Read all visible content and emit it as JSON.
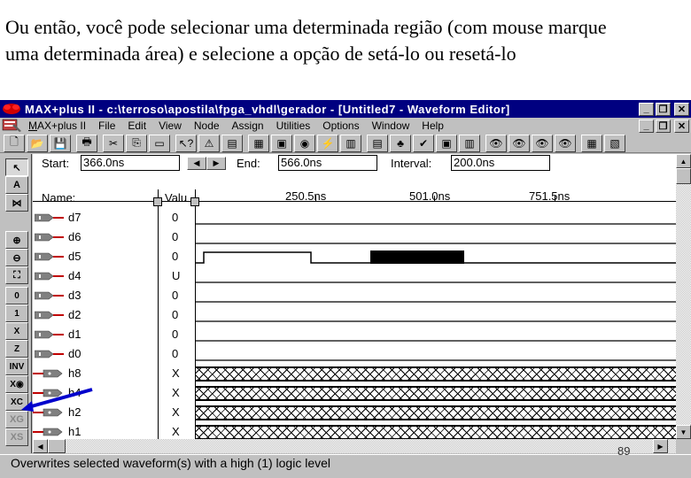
{
  "slide": {
    "line1": "Ou então, você pode selecionar uma determinada região (com mouse marque",
    "line2": "uma determinada área) e selecione a opção de setá-lo ou resetá-lo",
    "page_number": "89"
  },
  "window": {
    "title": "MAX+plus II - c:\\terroso\\apostila\\fpga_vhdl\\gerador - [Untitled7 - Waveform Editor]",
    "buttons": {
      "minimize": "_",
      "restore": "❐",
      "close": "✕"
    },
    "accent": "#000080"
  },
  "menu": {
    "items": [
      {
        "label": "MAX+plus II",
        "hotkey": "M"
      },
      {
        "label": "File",
        "hotkey": "F"
      },
      {
        "label": "Edit",
        "hotkey": "E"
      },
      {
        "label": "View",
        "hotkey": "V"
      },
      {
        "label": "Node",
        "hotkey": "N"
      },
      {
        "label": "Assign",
        "hotkey": "A"
      },
      {
        "label": "Utilities",
        "hotkey": "U"
      },
      {
        "label": "Options",
        "hotkey": "O"
      },
      {
        "label": "Window",
        "hotkey": "W"
      },
      {
        "label": "Help",
        "hotkey": "H"
      }
    ]
  },
  "toolbar": {
    "buttons": [
      {
        "name": "new-file",
        "glyph": "🗋"
      },
      {
        "name": "open-file",
        "glyph": "📂"
      },
      {
        "name": "save-file",
        "glyph": "💾"
      },
      {
        "name": "print",
        "glyph": "🖶"
      },
      {
        "name": "cut",
        "glyph": "✂"
      },
      {
        "name": "copy",
        "glyph": "⎘"
      },
      {
        "name": "paste",
        "glyph": "▭"
      },
      {
        "name": "context-help",
        "glyph": "↖?"
      },
      {
        "name": "messages",
        "glyph": "⚠"
      },
      {
        "name": "hierarchy-display",
        "glyph": "▤"
      },
      {
        "name": "floorplan-editor",
        "glyph": "▦"
      },
      {
        "name": "compiler",
        "glyph": "▣"
      },
      {
        "name": "simulator",
        "glyph": "◉"
      },
      {
        "name": "timing-analyzer",
        "glyph": "⚡"
      },
      {
        "name": "programmer",
        "glyph": "▥"
      },
      {
        "name": "project-set",
        "glyph": "▤"
      },
      {
        "name": "project-hierarchy",
        "glyph": "♣"
      },
      {
        "name": "save-and-check",
        "glyph": "✔"
      },
      {
        "name": "save-and-compile",
        "glyph": "▣"
      },
      {
        "name": "save-and-simulate",
        "glyph": "▥"
      },
      {
        "name": "find-node-a",
        "glyph": "👁"
      },
      {
        "name": "find-node-ra",
        "glyph": "👁"
      },
      {
        "name": "find-connection",
        "glyph": "👁"
      },
      {
        "name": "find-pin",
        "glyph": "👁"
      },
      {
        "name": "tile",
        "glyph": "▦"
      },
      {
        "name": "cascade",
        "glyph": "▧"
      }
    ]
  },
  "left_tools": [
    {
      "name": "selection-tool",
      "glyph": "↖"
    },
    {
      "name": "text-tool",
      "glyph": "A"
    },
    {
      "name": "waveform-editing-tool",
      "glyph": "⋈"
    },
    {
      "name": "zoom-in",
      "glyph": "⊕"
    },
    {
      "name": "zoom-out",
      "glyph": "⊖"
    },
    {
      "name": "fit-in-window",
      "glyph": "⛶"
    },
    {
      "name": "forcing-low-0",
      "glyph": "0"
    },
    {
      "name": "forcing-high-1",
      "glyph": "1"
    },
    {
      "name": "dont-care-x",
      "glyph": "X"
    },
    {
      "name": "high-impedance-z",
      "glyph": "Z"
    },
    {
      "name": "invert",
      "glyph": "INV"
    },
    {
      "name": "overwrite-count-value",
      "glyph": "X◉"
    },
    {
      "name": "overwrite-clock",
      "glyph": "XC"
    },
    {
      "name": "overwrite-group",
      "glyph": "XG"
    },
    {
      "name": "overwrite-state",
      "glyph": "XS"
    }
  ],
  "editor": {
    "start_label": "Start:",
    "start_value": "366.0ns",
    "end_label": "End:",
    "end_value": "566.0ns",
    "interval_label": "Interval:",
    "interval_value": "200.0ns",
    "name_header": "Name:",
    "value_header": "Valu",
    "time_ticks": [
      "250.5ns",
      "501.0ns",
      "751.5ns"
    ],
    "nav_left": "◀",
    "nav_right": "▶"
  },
  "signals": [
    {
      "name": "d7",
      "value": "0",
      "type": "input",
      "wave": "low"
    },
    {
      "name": "d6",
      "value": "0",
      "type": "input",
      "wave": "low"
    },
    {
      "name": "d5",
      "value": "0",
      "type": "input",
      "wave": "pulse-selected"
    },
    {
      "name": "d4",
      "value": "U",
      "type": "input",
      "wave": "low"
    },
    {
      "name": "d3",
      "value": "0",
      "type": "input",
      "wave": "low"
    },
    {
      "name": "d2",
      "value": "0",
      "type": "input",
      "wave": "low"
    },
    {
      "name": "d1",
      "value": "0",
      "type": "input",
      "wave": "low"
    },
    {
      "name": "d0",
      "value": "0",
      "type": "input",
      "wave": "low"
    },
    {
      "name": "h8",
      "value": "X",
      "type": "output",
      "wave": "unknown"
    },
    {
      "name": "h4",
      "value": "X",
      "type": "output",
      "wave": "unknown"
    },
    {
      "name": "h2",
      "value": "X",
      "type": "output",
      "wave": "unknown"
    },
    {
      "name": "h1",
      "value": "X",
      "type": "output",
      "wave": "unknown"
    }
  ],
  "status": {
    "text": "Overwrites selected waveform(s) with a high (1) logic level"
  },
  "scrollbar": {
    "up": "▲",
    "down": "▼",
    "left": "◀",
    "right": "▶"
  },
  "annotation": {
    "arrow_color": "#0000cc"
  }
}
